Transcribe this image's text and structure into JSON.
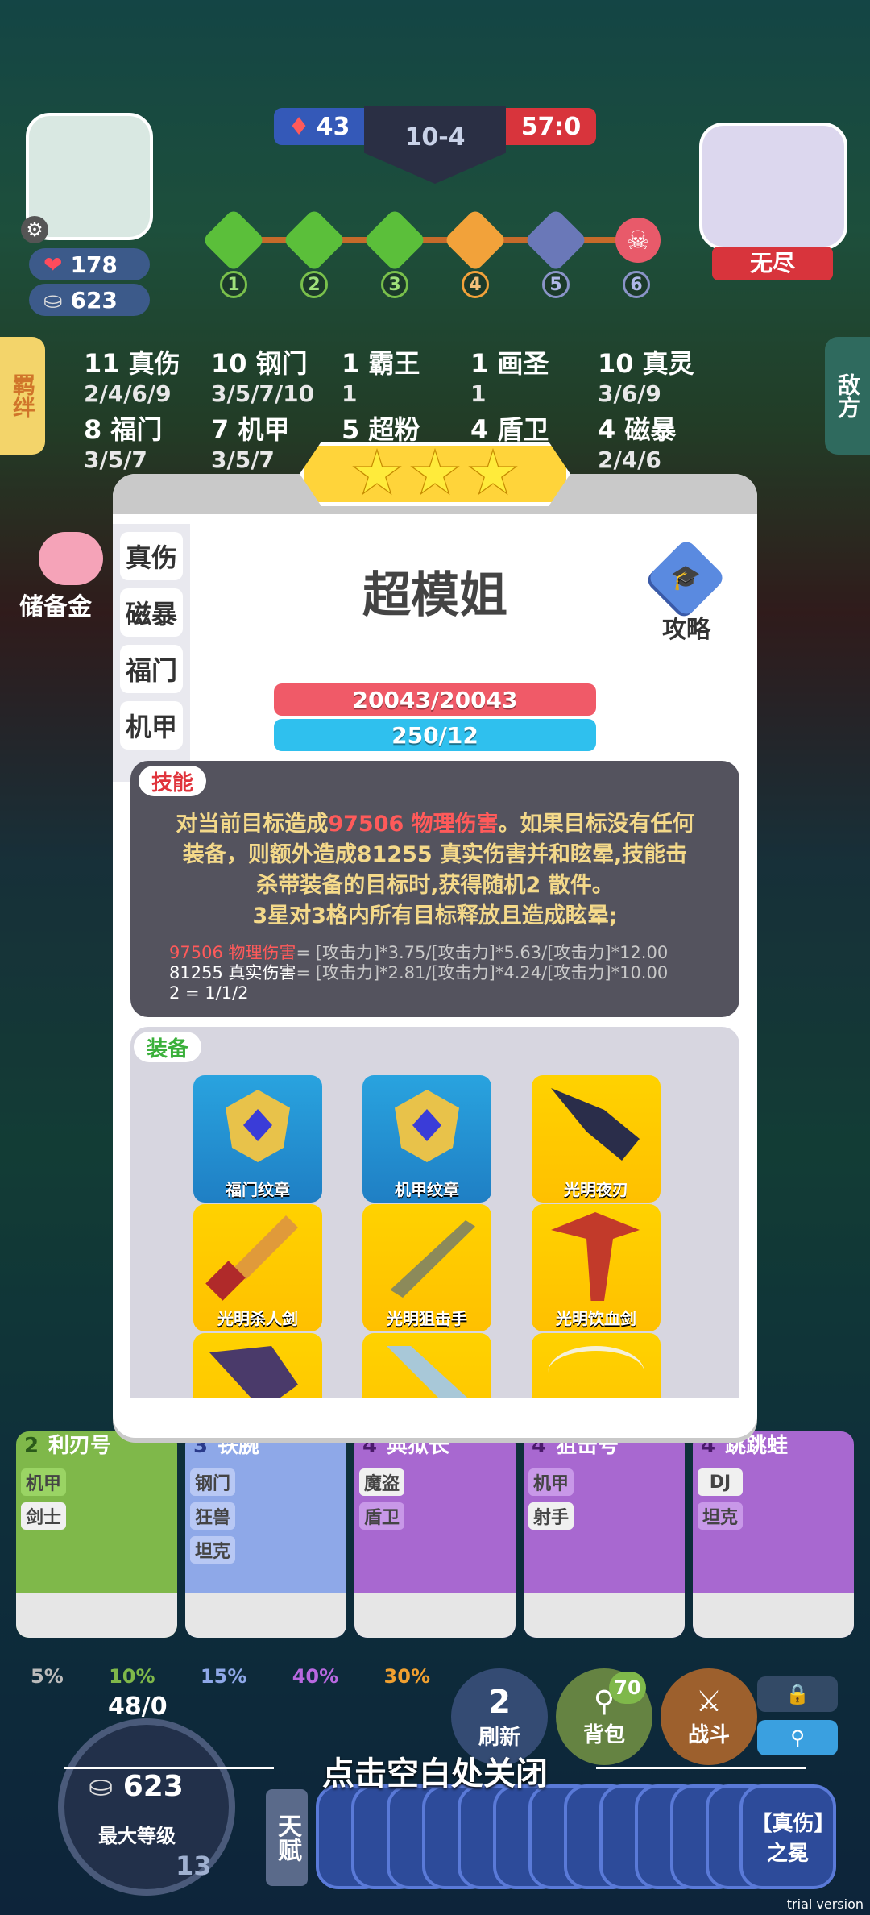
{
  "hud": {
    "hp": "178",
    "gold": "623",
    "left_score": "43",
    "round": "10-4",
    "right_score": "57:0",
    "opponent_name": "无尽",
    "stages": [
      "1",
      "2",
      "3",
      "4",
      "5",
      "6"
    ]
  },
  "left_tab": "羁绊",
  "right_tab": "敌方",
  "savings_label": "储备金",
  "traits": [
    {
      "name": "11 真伤",
      "tiers": "2/4/6/9"
    },
    {
      "name": "10 钢门",
      "tiers": "3/5/7/10"
    },
    {
      "name": "1 霸王",
      "tiers": "1"
    },
    {
      "name": "1 画圣",
      "tiers": "1"
    },
    {
      "name": "10 真灵",
      "tiers": "3/6/9"
    },
    {
      "name": "8 福门",
      "tiers": "3/5/7"
    },
    {
      "name": "7 机甲",
      "tiers": "3/5/7"
    },
    {
      "name": "5 超粉",
      "tiers": ""
    },
    {
      "name": "4 盾卫",
      "tiers": ""
    },
    {
      "name": "4 磁暴",
      "tiers": "2/4/6"
    }
  ],
  "modal": {
    "stars": 3,
    "side_tabs": [
      "真伤",
      "磁暴",
      "福门",
      "机甲"
    ],
    "hero_name": "超模姐",
    "guide_label": "攻略",
    "hp_bar": "20043/20043",
    "mana_bar": "250/12",
    "skill_tag": "技能",
    "skill_line1_a": "对当前目标造成",
    "skill_line1_dmg": "97506 物理伤害",
    "skill_line1_b": "。如果目标没有任何",
    "skill_line2": "装备，则额外造成81255 真实伤害并和眩晕,技能击",
    "skill_line3": "杀带装备的目标时,获得随机2 散件。",
    "skill_line4": "3星对3格内所有目标释放且造成眩晕;",
    "formula1_a": "97506 物理伤害",
    "formula1_b": "= [攻击力]*3.75/[攻击力]*5.63/[攻击力]*12.00",
    "formula2_a": "81255 真实伤害",
    "formula2_b": "= [攻击力]*2.81/[攻击力]*4.24/[攻击力]*10.00",
    "formula3": "2 = 1/1/2",
    "equip_tag": "装备",
    "equipment": [
      {
        "label": "福门纹章",
        "icon": "badge-icon",
        "color": "blue"
      },
      {
        "label": "机甲纹章",
        "icon": "badge-icon",
        "color": "blue"
      },
      {
        "label": "光明夜刃",
        "icon": "dagger-icon",
        "color": "yellow"
      },
      {
        "label": "光明杀人剑",
        "icon": "sword-icon",
        "color": "yellow"
      },
      {
        "label": "光明狙击手",
        "icon": "rifle-icon",
        "color": "yellow"
      },
      {
        "label": "光明饮血剑",
        "icon": "scythe-icon",
        "color": "yellow"
      },
      {
        "label": "",
        "icon": "claw-icon",
        "color": "yellow"
      },
      {
        "label": "",
        "icon": "blade-icon",
        "color": "yellow"
      },
      {
        "label": "",
        "icon": "bow-icon",
        "color": "yellow"
      }
    ]
  },
  "shop": [
    {
      "cost": "2",
      "name": "利刃号",
      "tags": [
        "机甲",
        "剑士"
      ],
      "color": "#8bc34a"
    },
    {
      "cost": "3",
      "name": "铁腕",
      "tags": [
        "钢门",
        "狂兽",
        "坦克"
      ],
      "color": "#9bb7ff"
    },
    {
      "cost": "4",
      "name": "典狱长",
      "tags": [
        "魔盗",
        "盾卫"
      ],
      "color": "#b06ad8"
    },
    {
      "cost": "4",
      "name": "狙击号",
      "tags": [
        "机甲",
        "射手"
      ],
      "color": "#b06ad8"
    },
    {
      "cost": "4",
      "name": "跳跳蛙",
      "tags": [
        "DJ",
        "坦克"
      ],
      "color": "#b06ad8"
    }
  ],
  "odds": [
    "5%",
    "10%",
    "15%",
    "40%",
    "30%"
  ],
  "bottom": {
    "xp": "48/0",
    "gold": "623",
    "level_label": "最大等级",
    "level": "13",
    "refresh_cost": "2",
    "refresh_label": "刷新",
    "bag_count": "70",
    "bag_label": "背包",
    "battle_label": "战斗",
    "talent_label": "天赋",
    "talent_last": "【真伤】之冕"
  },
  "close_hint": "点击空白处关闭",
  "watermark": "trial version"
}
